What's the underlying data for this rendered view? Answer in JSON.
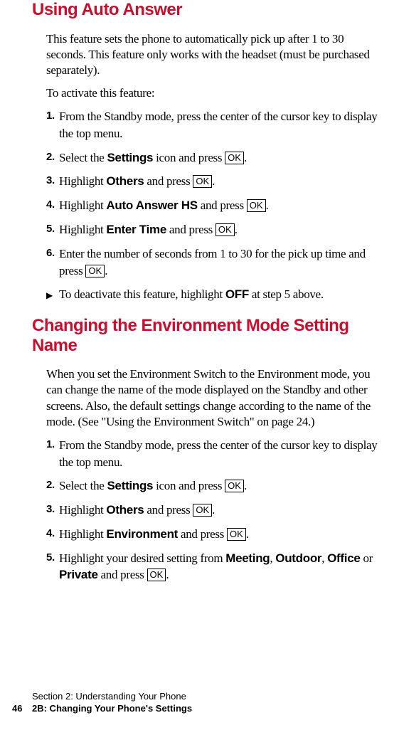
{
  "ok_label": "OK",
  "heading1": "Using Auto Answer",
  "section1": {
    "intro": "This feature sets the phone to automatically pick up after 1 to 30 seconds. This feature only works with the headset (must be purchased separately).",
    "activate": "To activate this feature:",
    "steps": {
      "s1": {
        "num": "1.",
        "text": "From the Standby mode, press the center of the cursor key to display the top menu."
      },
      "s2": {
        "num": "2.",
        "pre": "Select the ",
        "bold": "Settings",
        "mid": " icon and press ",
        "post": "."
      },
      "s3": {
        "num": "3.",
        "pre": "Highlight ",
        "bold": "Others",
        "mid": " and press ",
        "post": "."
      },
      "s4": {
        "num": "4.",
        "pre": "Highlight ",
        "bold": "Auto Answer HS",
        "mid": " and press ",
        "post": "."
      },
      "s5": {
        "num": "5.",
        "pre": "Highlight ",
        "bold": "Enter Time",
        "mid": " and press ",
        "post": "."
      },
      "s6": {
        "num": "6.",
        "pre": "Enter the number of seconds from 1 to 30 for the pick up time and press ",
        "post": "."
      }
    },
    "deactivate": {
      "pre": "To deactivate this feature, highlight ",
      "bold": "OFF",
      "post": " at step 5 above."
    }
  },
  "heading2": "Changing the Environment Mode Setting Name",
  "section2": {
    "intro": "When you set the Environment Switch to the Environment mode, you can change the name of the mode displayed on the Standby and other screens. Also, the default settings change according to the name of the mode. (See \"Using the Environment Switch\" on page 24.)",
    "steps": {
      "s1": {
        "num": "1.",
        "text": "From the Standby mode, press the center of the cursor key to display the top menu."
      },
      "s2": {
        "num": "2.",
        "pre": "Select the ",
        "bold": "Settings",
        "mid": " icon and press ",
        "post": "."
      },
      "s3": {
        "num": "3.",
        "pre": "Highlight ",
        "bold": "Others",
        "mid": " and press ",
        "post": "."
      },
      "s4": {
        "num": "4.",
        "pre": "Highlight ",
        "bold": "Environment",
        "mid": " and press ",
        "post": "."
      },
      "s5": {
        "num": "5.",
        "pre": "Highlight your desired setting from ",
        "b1": "Meeting",
        "c1": ", ",
        "b2": "Outdoor",
        "c2": ", ",
        "b3": "Office",
        "c3": " or ",
        "b4": "Private",
        "mid": " and press ",
        "post": "."
      }
    }
  },
  "footer": {
    "section": "Section 2: Understanding Your Phone",
    "page_num": "46",
    "chapter": "2B: Changing Your Phone's Settings"
  }
}
